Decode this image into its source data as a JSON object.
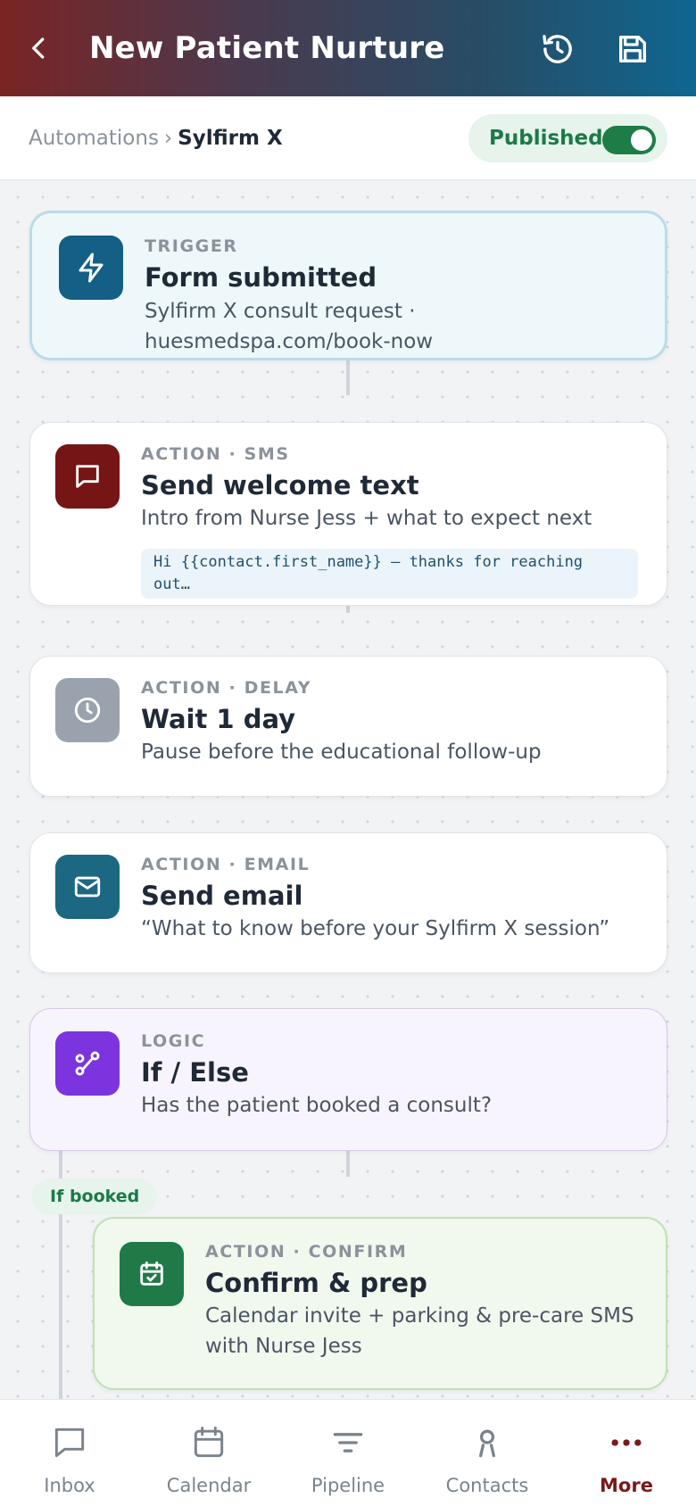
{
  "header": {
    "title": "New Patient Nurture",
    "back_icon": "back-chevron-icon",
    "history_icon": "history-icon",
    "save_icon": "save-icon",
    "gradient": [
      "#7a2424",
      "#0f6690"
    ]
  },
  "breadcrumb": {
    "parent": "Automations",
    "separator": "›",
    "current": "Sylfirm X"
  },
  "status": {
    "label": "Published",
    "enabled": true,
    "color": "#1e7d46"
  },
  "workflow": {
    "steps": [
      {
        "eyebrow": "TRIGGER",
        "title": "Form submitted",
        "desc_line1": "Sylfirm X consult request ·",
        "desc_line2": "huesmedspa.com/book-now",
        "icon": "lightning-icon",
        "color": "#135f86"
      },
      {
        "eyebrow": "ACTION · SMS",
        "title": "Send welcome text",
        "desc": "Intro from Nurse Jess + what to expect next",
        "preview": "Hi {{contact.first_name}} — thanks for reaching out…",
        "icon": "chat-icon",
        "color": "#751515"
      },
      {
        "eyebrow": "ACTION · DELAY",
        "title": "Wait 1 day",
        "desc": "Pause before the educational follow-up",
        "icon": "clock-icon",
        "color": "#9aa3ad"
      },
      {
        "eyebrow": "ACTION · EMAIL",
        "title": "Send email",
        "desc": "“What to know before your Sylfirm X session”",
        "icon": "mail-icon",
        "color": "#1c6883"
      },
      {
        "eyebrow": "LOGIC",
        "title": "If / Else",
        "desc": "Has the patient booked a consult?",
        "icon": "branch-icon",
        "color": "#7b34de"
      }
    ],
    "branch": {
      "label": "If booked",
      "step": {
        "eyebrow": "ACTION · CONFIRM",
        "title": "Confirm & prep",
        "desc_line1": "Calendar invite + parking & pre-care SMS",
        "desc_line2": "with Nurse Jess",
        "icon": "calendar-check-icon",
        "color": "#1f7a47"
      }
    }
  },
  "nav": {
    "items": [
      {
        "label": "Inbox",
        "icon": "inbox-icon"
      },
      {
        "label": "Calendar",
        "icon": "calendar-icon"
      },
      {
        "label": "Pipeline",
        "icon": "pipeline-icon"
      },
      {
        "label": "Contacts",
        "icon": "contacts-icon"
      },
      {
        "label": "More",
        "icon": "more-icon"
      }
    ],
    "active": "More"
  }
}
